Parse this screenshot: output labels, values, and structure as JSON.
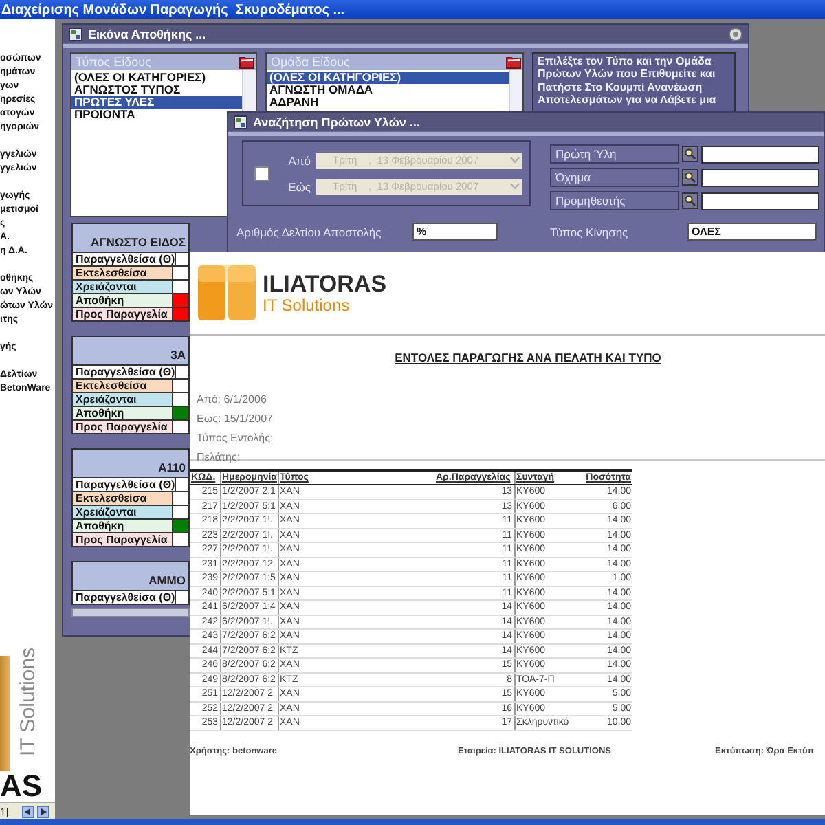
{
  "app": {
    "title": "Διαχείρισης Μονάδων Παραγωγής  Σκυροδέματος ..."
  },
  "sidebar": {
    "groups": [
      [
        "οσώπων",
        "ημάτων",
        "γων",
        "ηρεσίες",
        "ατογών",
        "ηγοριών"
      ],
      [
        "γγελιών",
        "γγελιών"
      ],
      [
        "γωγής",
        "μετισμοί",
        "ς",
        "Α.",
        "η Δ.Α."
      ],
      [
        "οθήκης",
        "ων Υλών",
        "ώτων Υλών",
        "ιτης"
      ],
      [
        "γής"
      ],
      [
        "Δελτίων",
        "BetonWare"
      ]
    ],
    "brand": {
      "tagline": "IT Solutions",
      "name": "AS"
    },
    "status": "1]"
  },
  "stock_window": {
    "title": "Εικόνα Αποθήκης ...",
    "type_list": {
      "header": "Τύπος Είδους",
      "items": [
        {
          "label": "(ΟΛΕΣ ΟΙ ΚΑΤΗΓΟΡΙΕΣ)",
          "selected": false
        },
        {
          "label": "ΑΓΝΩΣΤΟΣ ΤΥΠΟΣ",
          "selected": false
        },
        {
          "label": "ΠΡΩΤΕΣ ΥΛΕΣ",
          "selected": true
        },
        {
          "label": "ΠΡΟΪΟΝΤΑ",
          "selected": false
        }
      ]
    },
    "group_list": {
      "header": "Ομάδα Είδους",
      "items": [
        {
          "label": "(ΟΛΕΣ ΟΙ ΚΑΤΗΓΟΡΙΕΣ)",
          "selected": true
        },
        {
          "label": "ΑΓΝΩΣΤΗ ΟΜΑΔΑ",
          "selected": false
        },
        {
          "label": "ΑΔΡΑΝΗ",
          "selected": false
        }
      ]
    },
    "instructions": "Επιλέξτε τον Τύπο και την Ομάδα Πρώτων Υλών που Επιθυμείτε και Πατήστε Στο Κουμπί Ανανέωση Αποτελεσμάτων για να Λάβετε μια",
    "cards": [
      {
        "title": "ΑΓΝΩΣΤΟ ΕΙΔΟΣ",
        "rows": [
          {
            "kind": "ordered",
            "label": "Παραγγελθείσα (Θ)",
            "color": "#ffffff"
          },
          {
            "kind": "executed",
            "label": "Εκτελεσθείσα",
            "color": "#ffffff"
          },
          {
            "kind": "needed",
            "label": "Χρειάζονται",
            "color": "#ffffff"
          },
          {
            "kind": "stock",
            "label": "Αποθήκη",
            "color": "#ff0000"
          },
          {
            "kind": "to_order",
            "label": "Προς Παραγγελία",
            "color": "#ff0000"
          }
        ]
      },
      {
        "title": "3Α",
        "rows": [
          {
            "kind": "ordered",
            "label": "Παραγγελθείσα (Θ)",
            "color": "#ffffff"
          },
          {
            "kind": "executed",
            "label": "Εκτελεσθείσα",
            "color": "#ffffff"
          },
          {
            "kind": "needed",
            "label": "Χρειάζονται",
            "color": "#ffffff"
          },
          {
            "kind": "stock",
            "label": "Αποθήκη",
            "color": "#008000"
          },
          {
            "kind": "to_order",
            "label": "Προς Παραγγελία",
            "color": "#ffffff"
          }
        ]
      },
      {
        "title": "Α110",
        "rows": [
          {
            "kind": "ordered",
            "label": "Παραγγελθείσα (Θ)",
            "color": "#ffffff"
          },
          {
            "kind": "executed",
            "label": "Εκτελεσθείσα",
            "color": "#ffffff"
          },
          {
            "kind": "needed",
            "label": "Χρειάζονται",
            "color": "#ffffff"
          },
          {
            "kind": "stock",
            "label": "Αποθήκη",
            "color": "#008000"
          },
          {
            "kind": "to_order",
            "label": "Προς Παραγγελία",
            "color": "#ffffff"
          }
        ]
      },
      {
        "title": "ΑΜΜΟ",
        "rows": [
          {
            "kind": "ordered",
            "label": "Παραγγελθείσα (Θ)",
            "color": "#ffffff"
          }
        ]
      }
    ]
  },
  "search_window": {
    "title": "Αναζήτηση Πρώτων Υλών ...",
    "date_filter": {
      "enabled": false,
      "from": {
        "label": "Από",
        "value": "Τρίτη    ,  13 Φεβρουαρίου 2007"
      },
      "to": {
        "label": "Εώς",
        "value": "Τρίτη    ,  13 Φεβρουαρίου 2007"
      }
    },
    "lookups": [
      {
        "label": "Πρώτη Ύλη"
      },
      {
        "label": "Όχημα"
      },
      {
        "label": "Προμηθευτής"
      }
    ],
    "delivery_note": {
      "label": "Αριθμός Δελτίου Αποστολής",
      "value": "%"
    },
    "movement_type": {
      "label": "Τύπος Κίνησης",
      "value": "ΟΛΕΣ"
    }
  },
  "report": {
    "company": "ILIATORAS",
    "tagline": "IT Solutions",
    "title": "ΕΝΤΟΛΕΣ ΠΑΡΑΓΩΓΗΣ ΑΝΑ ΠΕΛΑΤΗ ΚΑΙ ΤΥΠΟ",
    "meta": [
      "Από: 6/1/2006",
      "Εως: 15/1/2007",
      "Τύπος Εντολής:",
      "Πελάτης:"
    ],
    "columns": [
      "ΚΩΔ.",
      "Ημερομηνία",
      "Τύπος",
      "Αρ.Παραγγελίας",
      "Συνταγή",
      "Ποσότητα"
    ],
    "rows": [
      [
        "215",
        "1/2/2007 2:1",
        "ΧΑΝ",
        "13",
        "ΚΥ600",
        "14,00"
      ],
      [
        "217",
        "1/2/2007 5:1",
        "ΧΑΝ",
        "13",
        "ΚΥ600",
        "6,00"
      ],
      [
        "218",
        "2/2/2007 1!.",
        "ΧΑΝ",
        "11",
        "ΚΥ600",
        "14,00"
      ],
      [
        "223",
        "2/2/2007 1!.",
        "ΧΑΝ",
        "11",
        "ΚΥ600",
        "14,00"
      ],
      [
        "227",
        "2/2/2007 1!.",
        "ΧΑΝ",
        "11",
        "ΚΥ600",
        "14,00"
      ],
      [
        "231",
        "2/2/2007 12.",
        "ΧΑΝ",
        "11",
        "ΚΥ600",
        "14,00"
      ],
      [
        "239",
        "2/2/2007 1:5",
        "ΧΑΝ",
        "11",
        "ΚΥ600",
        "1,00"
      ],
      [
        "240",
        "2/2/2007 5:1",
        "ΧΑΝ",
        "11",
        "ΚΥ600",
        "14,00"
      ],
      [
        "241",
        "6/2/2007 1:4",
        "ΧΑΝ",
        "14",
        "ΚΥ600",
        "14,00"
      ],
      [
        "242",
        "6/2/2007 1!.",
        "ΧΑΝ",
        "14",
        "ΚΥ600",
        "14,00"
      ],
      [
        "243",
        "7/2/2007 6:2",
        "ΧΑΝ",
        "14",
        "ΚΥ600",
        "14,00"
      ],
      [
        "244",
        "7/2/2007 6:2",
        "ΚΤΖ",
        "14",
        "ΚΥ600",
        "14,00"
      ],
      [
        "246",
        "8/2/2007 6:2",
        "ΧΑΝ",
        "15",
        "ΚΥ600",
        "14,00"
      ],
      [
        "249",
        "8/2/2007 6:2",
        "ΚΤΖ",
        "8",
        "ΤΟΑ-7-Π",
        "14,00"
      ],
      [
        "251",
        "12/2/2007 2",
        "ΧΑΝ",
        "15",
        "ΚΥ600",
        "5,00"
      ],
      [
        "252",
        "12/2/2007 2",
        "ΧΑΝ",
        "16",
        "ΚΥ600",
        "5,00"
      ],
      [
        "253",
        "12/2/2007 2",
        "ΧΑΝ",
        "17",
        "Σκληρυντικό",
        "10,00"
      ]
    ],
    "footer": [
      "Χρήστης: betonware",
      "Εταιρεία: ILIATORAS IT SOLUTIONS",
      "Εκτύπωση: Ώρα Εκτύπ"
    ]
  }
}
